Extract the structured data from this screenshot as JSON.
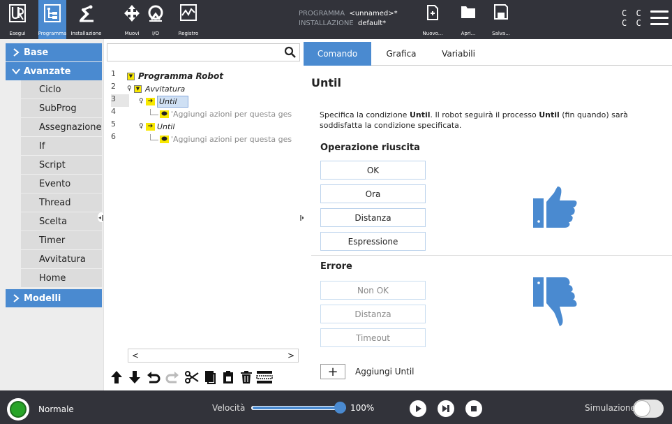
{
  "header": {
    "nav": [
      {
        "id": "esegui",
        "label": "Esegui",
        "icon": "ur-logo-icon"
      },
      {
        "id": "programma",
        "label": "Programma",
        "icon": "program-tree-icon",
        "active": true
      },
      {
        "id": "installazione",
        "label": "Installazione",
        "icon": "robot-arm-icon"
      },
      {
        "id": "muovi",
        "label": "Muovi",
        "icon": "move-arrows-icon"
      },
      {
        "id": "io",
        "label": "I/O",
        "icon": "io-icon"
      },
      {
        "id": "registro",
        "label": "Registro",
        "icon": "log-chart-icon"
      }
    ],
    "program_key": "PROGRAMMA",
    "program_val": "<unnamed>*",
    "install_key": "INSTALLAZIONE",
    "install_val": "default*",
    "file_buttons": [
      {
        "label": "Nuovo...",
        "icon": "new-file-icon"
      },
      {
        "label": "Apri...",
        "icon": "folder-icon"
      },
      {
        "label": "Salva...",
        "icon": "save-icon"
      }
    ],
    "cc_line1": "C C",
    "cc_line2": "C C"
  },
  "leftmenu": {
    "categories": [
      {
        "label": "Base",
        "expanded": false
      },
      {
        "label": "Avanzate",
        "expanded": true
      },
      {
        "label": "Modelli",
        "expanded": false
      }
    ],
    "items": [
      "Ciclo",
      "SubProg",
      "Assegnazione",
      "If",
      "Script",
      "Evento",
      "Thread",
      "Scelta",
      "Timer",
      "Avvitatura",
      "Home"
    ]
  },
  "tree": {
    "search_placeholder": "",
    "line_numbers": [
      "1",
      "2",
      "3",
      "4",
      "5",
      "6"
    ],
    "rows": [
      {
        "text": "Programma Robot"
      },
      {
        "text": "Avvitatura"
      },
      {
        "text": "Until"
      },
      {
        "text": "'Aggiungi azioni per questa ges"
      },
      {
        "text": "Until"
      },
      {
        "text": "'Aggiungi azioni per questa ges"
      }
    ]
  },
  "right": {
    "tabs": [
      "Comando",
      "Grafica",
      "Variabili"
    ],
    "title": "Until",
    "desc_p1": "Specifica la condizione ",
    "desc_b1": "Until",
    "desc_p2": ". Il robot seguirà il processo ",
    "desc_b2": "Until",
    "desc_p3": " (fin quando) sarà soddisfatta la condizione specificata.",
    "success_heading": "Operazione riuscita",
    "success_buttons": [
      "OK",
      "Ora",
      "Distanza",
      "Espressione"
    ],
    "error_heading": "Errore",
    "error_buttons": [
      "Non OK",
      "Distanza",
      "Timeout"
    ],
    "add_label": "Aggiungi Until",
    "thumb_color": "#4a8ad0"
  },
  "footer": {
    "mode": "Normale",
    "speed_label": "Velocità",
    "speed_value": "100%",
    "speed_fraction": 1.0,
    "sim_label": "Simulazione",
    "status_color": "#28a428"
  }
}
